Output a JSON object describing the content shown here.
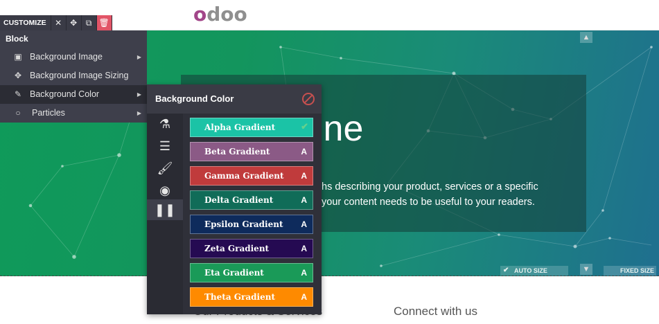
{
  "navbar": {
    "logo": "odoo"
  },
  "hero": {
    "headline": "ine",
    "line1": "hs describing your product, services or a specific",
    "line2": "your content needs to be useful to your readers."
  },
  "size_controls": {
    "auto": "AUTO SIZE",
    "fixed": "FIXED SIZE"
  },
  "below": {
    "left": "Our Products & Services",
    "right": "Connect with us"
  },
  "toolbar": {
    "customize_label": "CUSTOMIZE"
  },
  "menu": {
    "heading": "Block",
    "items": [
      {
        "label": "Background Image",
        "icon": "image-icon",
        "submenu": true
      },
      {
        "label": "Background Image Sizing",
        "icon": "move-arrows-icon",
        "submenu": false
      },
      {
        "label": "Background Color",
        "icon": "eyedropper-icon",
        "submenu": true
      },
      {
        "label": "Particles",
        "icon": "circle-icon",
        "submenu": true
      }
    ]
  },
  "bg_color_panel": {
    "title": "Background Color",
    "tabs": [
      "flask-icon",
      "database-icon",
      "paint-brush-icon",
      "eye-slash-icon",
      "pause-columns-icon"
    ],
    "gradients": [
      {
        "label": "Alpha Gradient",
        "color": "#1bc3a6",
        "badge": ""
      },
      {
        "label": "Beta Gradient",
        "color": "#8b5a86",
        "badge": "A"
      },
      {
        "label": "Gamma Gradient",
        "color": "#c03b3c",
        "badge": "A"
      },
      {
        "label": "Delta Gradient",
        "color": "#106c58",
        "badge": "A"
      },
      {
        "label": "Epsilon Gradient",
        "color": "#0e2b5c",
        "badge": "A"
      },
      {
        "label": "Zeta Gradient",
        "color": "#250a52",
        "badge": "A"
      },
      {
        "label": "Eta Gradient",
        "color": "#1a9a58",
        "badge": "A"
      },
      {
        "label": "Theta Gradient",
        "color": "#fe8a00",
        "badge": "A"
      }
    ]
  }
}
